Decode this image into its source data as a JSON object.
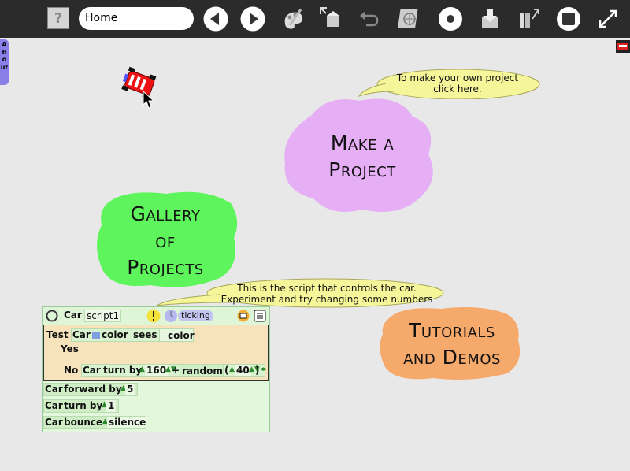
{
  "toolbar": {
    "help_label": "?",
    "location": "Home",
    "icons": [
      "help-icon",
      "back-arrow-icon",
      "forward-arrow-icon",
      "paint-icon",
      "object-catalog-icon",
      "undo-icon",
      "publish-icon",
      "record-icon",
      "load-project-icon",
      "supplies-icon",
      "stop-icon",
      "fullscreen-icon"
    ]
  },
  "about_tab": {
    "label": "About"
  },
  "bubbles": {
    "make_project_tip": [
      "To make your own project",
      "click here."
    ],
    "script_tip": [
      "This is the script that controls the car.",
      "Experiment and try changing some numbers"
    ]
  },
  "blobs": {
    "make_project": {
      "lines": [
        "Make a",
        "Project"
      ],
      "color": "#e6aef5"
    },
    "gallery": {
      "lines": [
        "Gallery",
        "of",
        "Projects"
      ],
      "color": "#5ef55c"
    },
    "tutorials": {
      "lines": [
        "Tutorials",
        "and Demos"
      ],
      "color": "#f5a96b"
    }
  },
  "script": {
    "object_name": "Car",
    "script_name": "script1",
    "status": "ticking",
    "test_label": "Test",
    "test_object": "Car",
    "test_color_label": "color",
    "test_sees_label": "sees",
    "test_color2_label": "color",
    "yes_label": "Yes",
    "no_label": "No",
    "no_object": "Car",
    "no_command": "turn by",
    "no_value": "160",
    "plus": "+",
    "random_label": "random",
    "open_paren": "(",
    "random_value": "40",
    "close_paren": ")",
    "rows": [
      {
        "object": "Car",
        "command": "forward by",
        "value": "5"
      },
      {
        "object": "Car",
        "command": "turn by",
        "value": "1"
      },
      {
        "object": "Car",
        "command": "bounce",
        "value": "silence"
      }
    ],
    "colors": {
      "panel": "#e2f7dc",
      "test": "#f6e3bc",
      "tile": "#cfeec6",
      "sees_swatch": "#7fa0e0"
    }
  }
}
